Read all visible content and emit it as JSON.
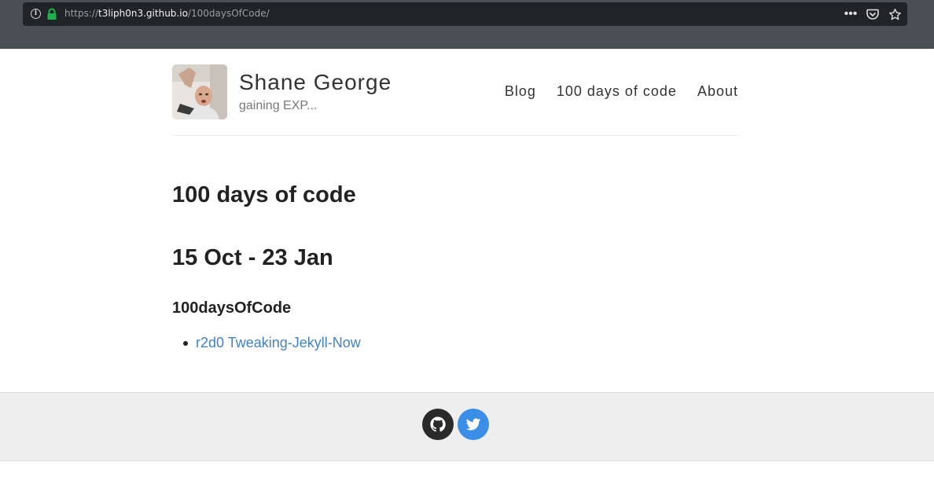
{
  "browser": {
    "url_prefix": "https://",
    "url_host": "t3liph0n3.github.io",
    "url_path": "/100daysOfCode/"
  },
  "site": {
    "name": "Shane George",
    "description": "gaining EXP..."
  },
  "nav": {
    "items": [
      {
        "label": "Blog"
      },
      {
        "label": "100 days of code"
      },
      {
        "label": "About"
      }
    ]
  },
  "content": {
    "title": "100 days of code",
    "subtitle": "15 Oct - 23 Jan",
    "section_heading": "100daysOfCode",
    "links": [
      {
        "label": "r2d0 Tweaking-Jekyll-Now"
      }
    ]
  },
  "footer": {
    "icons": [
      "github-icon",
      "twitter-icon"
    ]
  },
  "colors": {
    "link": "#4183c4",
    "twitter": "#3a8ee8",
    "github": "#2a2a2a",
    "secure_lock": "#22b14c"
  }
}
